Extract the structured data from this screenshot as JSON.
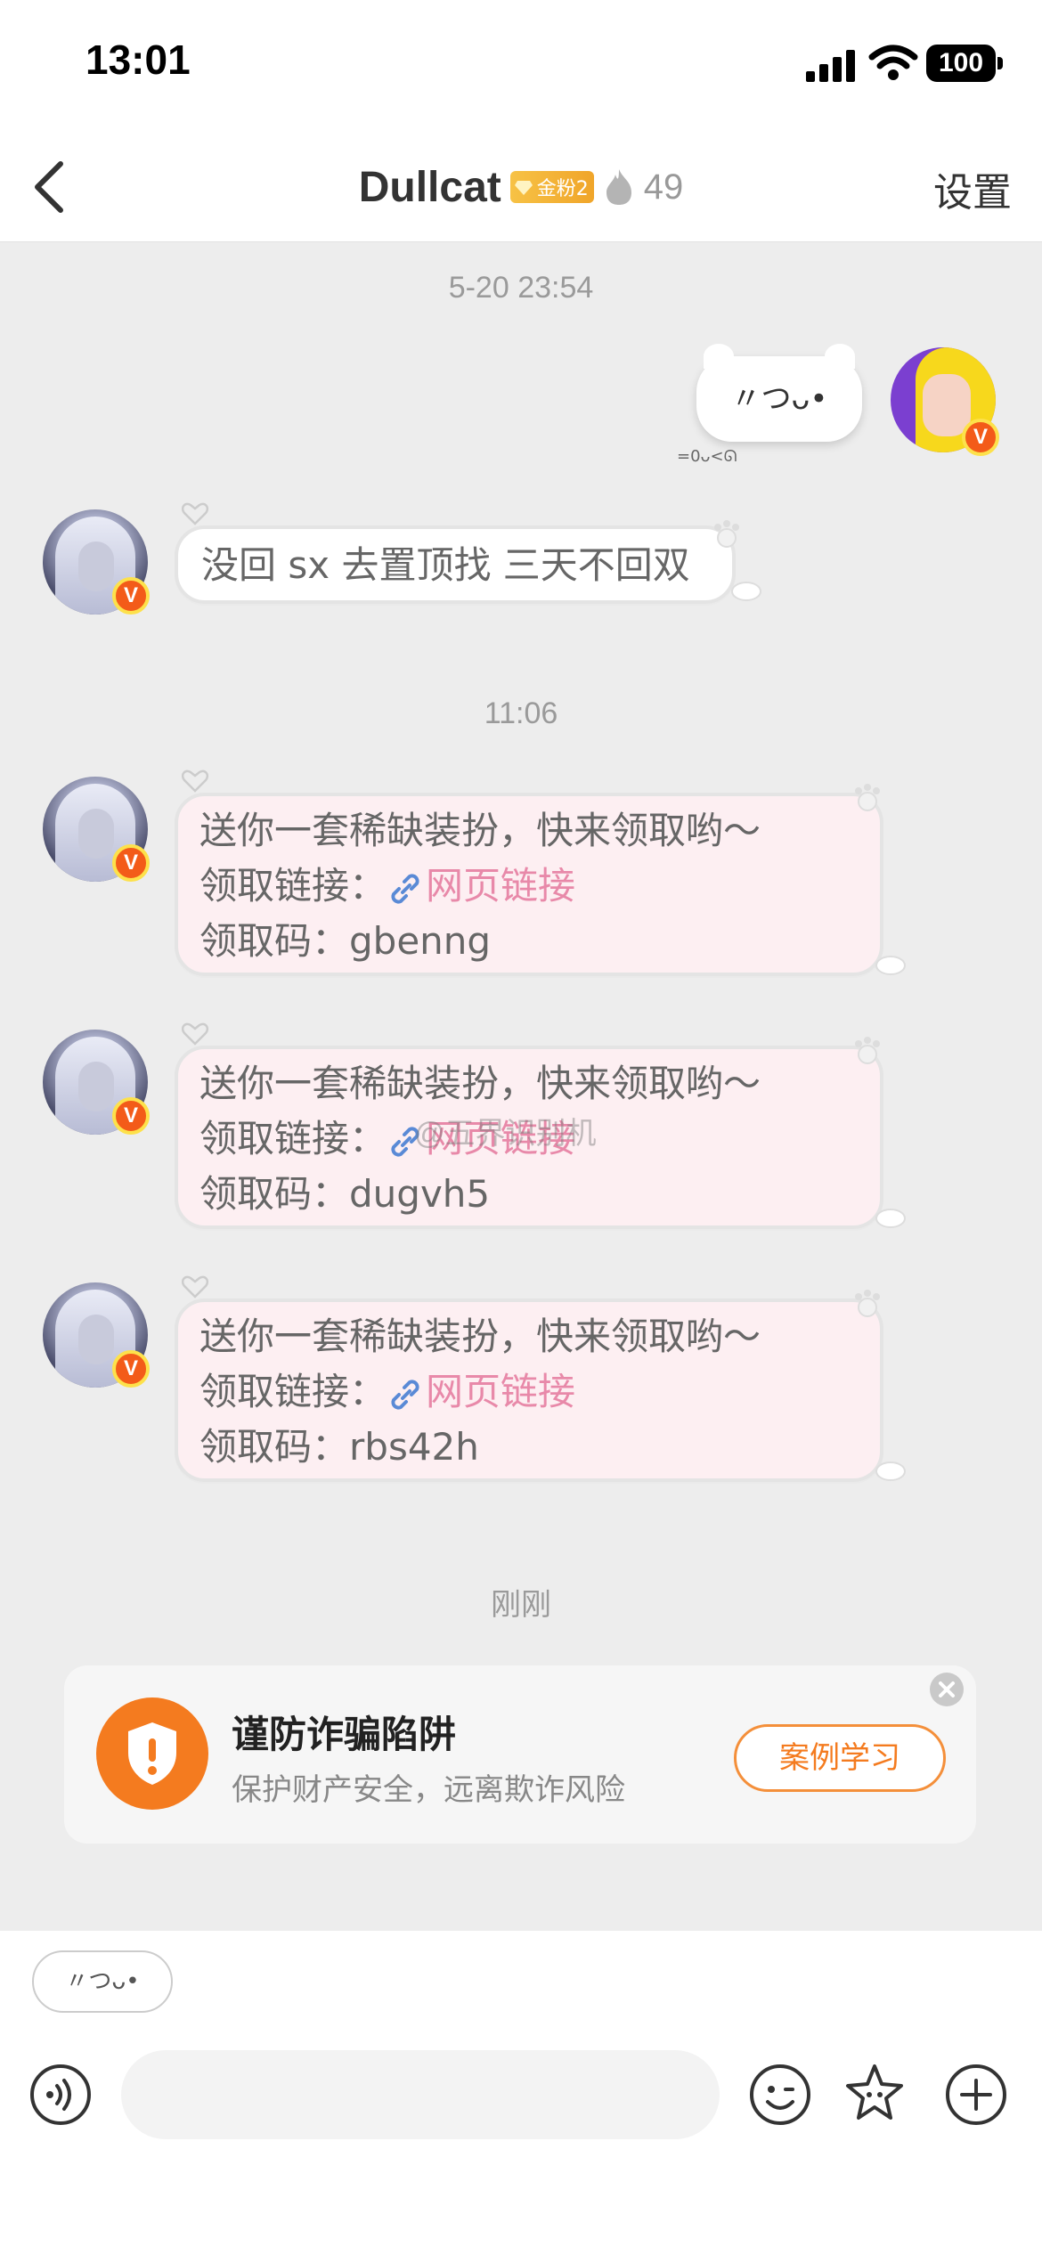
{
  "status_bar": {
    "time": "13:01",
    "battery": "100"
  },
  "nav": {
    "title": "Dullcat",
    "fan_badge": "金粉2",
    "count": "49",
    "settings": "设置"
  },
  "timestamps": [
    "5-20 23:54",
    "11:06",
    "刚刚"
  ],
  "sticker": {
    "face": "〃つᴗ•",
    "caption": "=0ᴗ<ᘏ"
  },
  "messages": [
    {
      "lines": [
        "没回 sx 去置顶找 三天不回双"
      ]
    },
    {
      "line1": "送你一套稀缺装扮，快来领取哟～",
      "link_label": "领取链接：",
      "link_text": "网页链接",
      "code_label": "领取码：",
      "code": "gbenng"
    },
    {
      "line1": "送你一套稀缺装扮，快来领取哟～",
      "link_label": "领取链接：",
      "link_text": "网页链接",
      "code_label": "领取码：",
      "code": "dugvh5"
    },
    {
      "line1": "送你一套稀缺装扮，快来领取哟～",
      "link_label": "领取链接：",
      "link_text": "网页链接",
      "code_label": "领取码：",
      "code": "rbs42h"
    }
  ],
  "watermark": "@五界识别机",
  "fraud_card": {
    "title": "谨防诈骗陷阱",
    "subtitle": "保护财产安全，远离欺诈风险",
    "button": "案例学习"
  },
  "input": {
    "sticker_chip": "〃つᴗ•",
    "placeholder": ""
  },
  "colors": {
    "accent_orange": "#f47b1f",
    "link_pink": "#e889a9",
    "bubble_pink": "#fdeff2",
    "verified_badge": "#f35b19"
  }
}
